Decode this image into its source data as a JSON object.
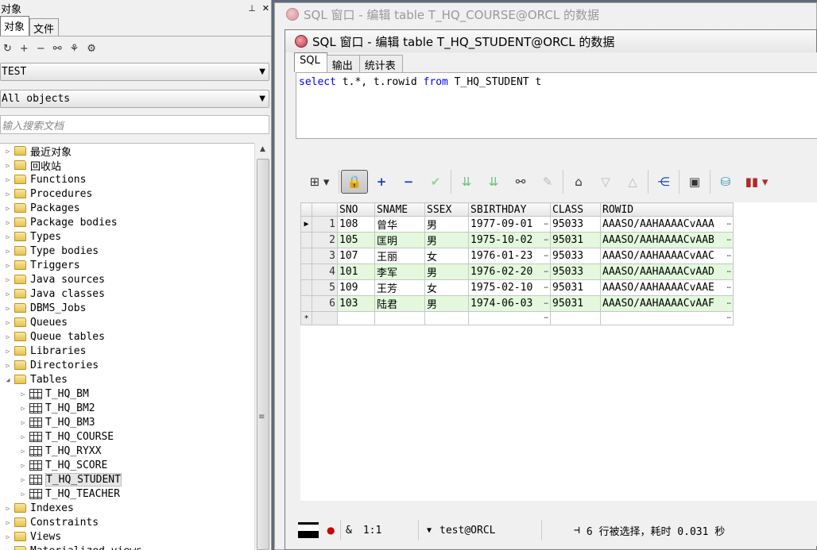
{
  "left_panel": {
    "title": "对象",
    "pin_icon": "pin-icon",
    "close_icon": "close-icon",
    "tabs": [
      {
        "label": "对象"
      },
      {
        "label": "文件"
      }
    ],
    "tools": [
      "refresh-icon",
      "add-icon",
      "remove-icon",
      "find-icon",
      "filter-icon",
      "filter-settings-icon"
    ],
    "user_combo": "TEST",
    "filter_combo": "All objects",
    "search_placeholder": "输入搜索文档",
    "tree": [
      {
        "label": "最近对象"
      },
      {
        "label": "回收站"
      },
      {
        "label": "Functions"
      },
      {
        "label": "Procedures"
      },
      {
        "label": "Packages"
      },
      {
        "label": "Package bodies"
      },
      {
        "label": "Types"
      },
      {
        "label": "Type bodies"
      },
      {
        "label": "Triggers"
      },
      {
        "label": "Java sources"
      },
      {
        "label": "Java classes"
      },
      {
        "label": "DBMS_Jobs"
      },
      {
        "label": "Queues"
      },
      {
        "label": "Queue tables"
      },
      {
        "label": "Libraries"
      },
      {
        "label": "Directories"
      },
      {
        "label": "Tables"
      },
      {
        "label": "T_HQ_BM"
      },
      {
        "label": "T_HQ_BM2"
      },
      {
        "label": "T_HQ_BM3"
      },
      {
        "label": "T_HQ_COURSE"
      },
      {
        "label": "T_HQ_RYXX"
      },
      {
        "label": "T_HQ_SCORE"
      },
      {
        "label": "T_HQ_STUDENT"
      },
      {
        "label": "T_HQ_TEACHER"
      },
      {
        "label": "Indexes"
      },
      {
        "label": "Constraints"
      },
      {
        "label": "Views"
      },
      {
        "label": "Materialized views"
      }
    ]
  },
  "back_window": {
    "title": "SQL 窗口 - 编辑 table T_HQ_COURSE@ORCL 的数据"
  },
  "window": {
    "title": "SQL 窗口 - 编辑 table T_HQ_STUDENT@ORCL 的数据",
    "tabs": [
      {
        "label": "SQL"
      },
      {
        "label": "输出"
      },
      {
        "label": "统计表"
      }
    ],
    "sql": {
      "kw1": "select",
      "mid": " t.*, t.rowid ",
      "kw2": "from",
      "rest": " T_HQ_STUDENT t"
    }
  },
  "grid": {
    "columns": [
      "SNO",
      "SNAME",
      "SSEX",
      "SBIRTHDAY",
      "CLASS",
      "ROWID"
    ],
    "rows": [
      {
        "n": "1",
        "cells": [
          "108",
          "曾华",
          "男",
          "1977-09-01",
          "95033",
          "AAASO/AAHAAAACvAAA"
        ]
      },
      {
        "n": "2",
        "cells": [
          "105",
          "匡明",
          "男",
          "1975-10-02",
          "95031",
          "AAASO/AAHAAAACvAAB"
        ]
      },
      {
        "n": "3",
        "cells": [
          "107",
          "王丽",
          "女",
          "1976-01-23",
          "95033",
          "AAASO/AAHAAAACvAAC"
        ]
      },
      {
        "n": "4",
        "cells": [
          "101",
          "李军",
          "男",
          "1976-02-20",
          "95033",
          "AAASO/AAHAAAACvAAD"
        ]
      },
      {
        "n": "5",
        "cells": [
          "109",
          "王芳",
          "女",
          "1975-02-10",
          "95031",
          "AAASO/AAHAAAACvAAE"
        ]
      },
      {
        "n": "6",
        "cells": [
          "103",
          "陆君",
          "男",
          "1974-06-03",
          "95031",
          "AAASO/AAHAAAACvAAF"
        ]
      }
    ],
    "new_row_marker": "*",
    "current_marker": "▶"
  },
  "status": {
    "amp": "&",
    "position": "1:1",
    "connection": "test@ORCL",
    "message": "6 行被选择，耗时 0.031 秒"
  }
}
